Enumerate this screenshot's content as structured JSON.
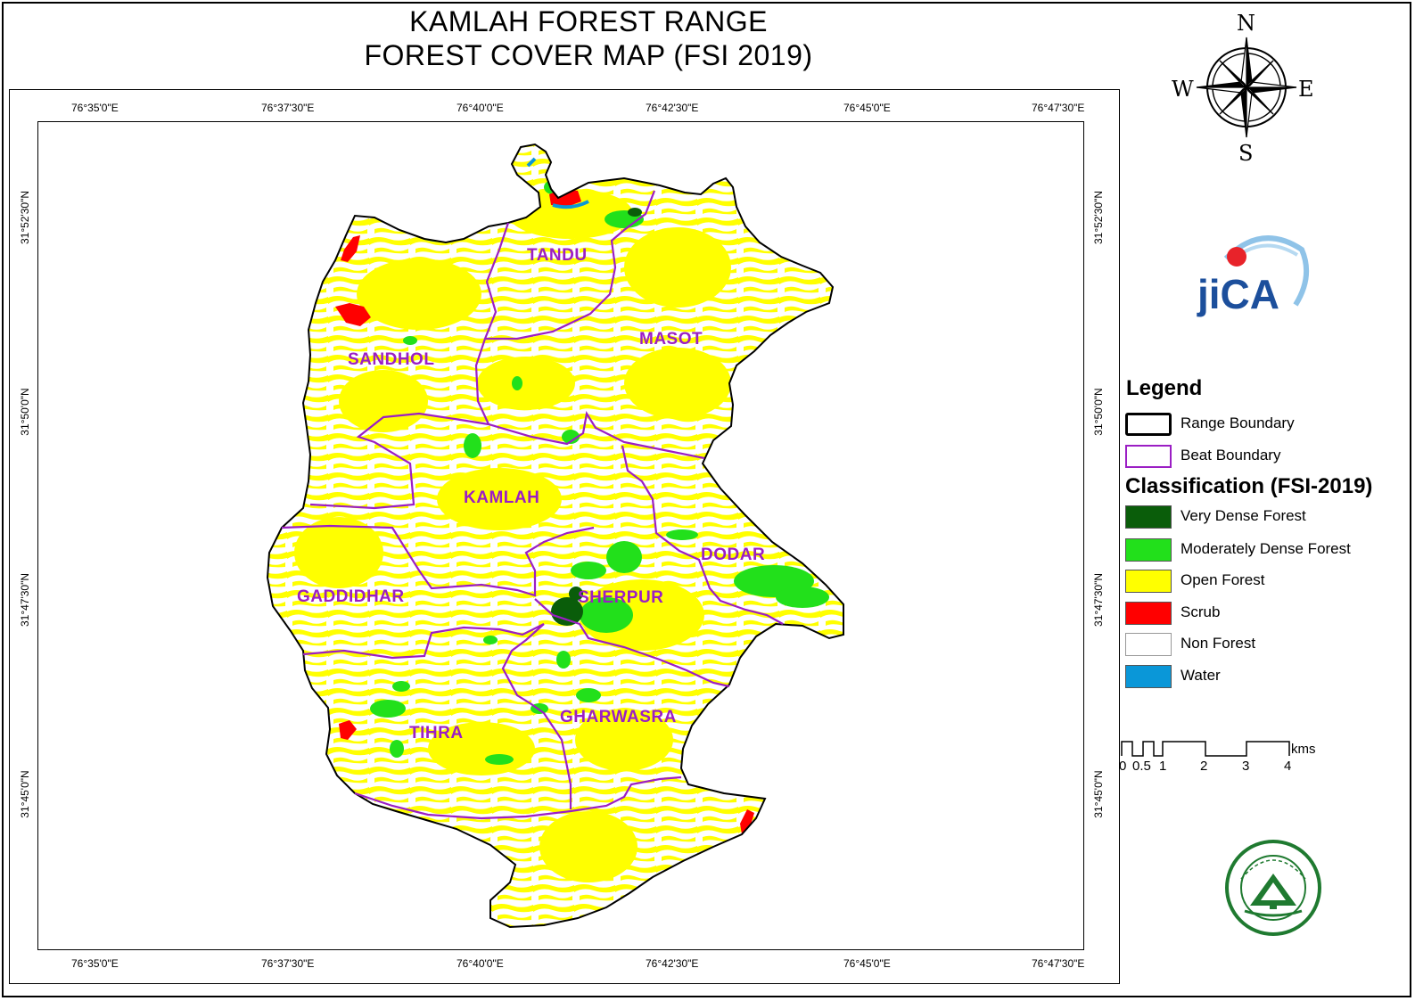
{
  "title": {
    "line1": "KAMLAH FOREST RANGE",
    "line2": "FOREST COVER MAP (FSI 2019)"
  },
  "grid": {
    "lon_labels": [
      "76°35'0\"E",
      "76°37'30\"E",
      "76°40'0\"E",
      "76°42'30\"E",
      "76°45'0\"E",
      "76°47'30\"E"
    ],
    "lat_labels": [
      "31°52'30\"N",
      "31°50'0\"N",
      "31°47'30\"N",
      "31°45'0\"N"
    ]
  },
  "beats": [
    {
      "label": "TANDU"
    },
    {
      "label": "MASOT"
    },
    {
      "label": "SANDHOL"
    },
    {
      "label": "KAMLAH"
    },
    {
      "label": "DODAR"
    },
    {
      "label": "GADDIDHAR"
    },
    {
      "label": "SHERPUR"
    },
    {
      "label": "TIHRA"
    },
    {
      "label": "GHARWASRA"
    }
  ],
  "compass": {
    "n": "N",
    "s": "S",
    "e": "E",
    "w": "W"
  },
  "logos": {
    "jica": "JICA",
    "forest_dept_seal_text": "वन विभाग हिमाचल प्रदेश"
  },
  "legend": {
    "title": "Legend",
    "boundaries": [
      {
        "label": "Range Boundary",
        "color": "#000000"
      },
      {
        "label": "Beat Boundary",
        "color": "#9b1ec4"
      }
    ],
    "classification_title": "Classification (FSI-2019)",
    "classes": [
      {
        "label": "Very Dense Forest",
        "color": "#0a5d0a"
      },
      {
        "label": "Moderately Dense Forest",
        "color": "#22e01b"
      },
      {
        "label": "Open Forest",
        "color": "#ffff00"
      },
      {
        "label": "Scrub",
        "color": "#ff0000"
      },
      {
        "label": "Non Forest",
        "color": "#ffffff"
      },
      {
        "label": "Water",
        "color": "#0a97d8"
      }
    ]
  },
  "scalebar": {
    "labels": [
      "0",
      "0.5",
      "1",
      "2",
      "3",
      "4"
    ],
    "unit": "kms"
  }
}
